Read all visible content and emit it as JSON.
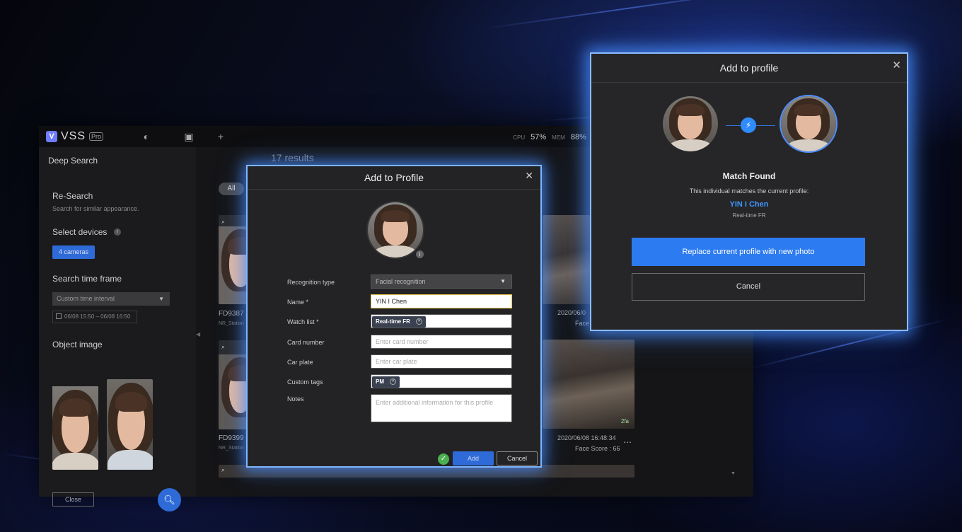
{
  "app": {
    "logo": "VSS",
    "logo_badge": "Pro",
    "cpu_label": "CPU",
    "cpu_value": "57%",
    "mem_label": "MEM",
    "mem_value": "88%",
    "page_title": "Deep Search"
  },
  "sidebar": {
    "research_title": "Re-Search",
    "research_sub": "Search for similar appearance.",
    "devices_title": "Select devices",
    "cameras_button": "4 cameras",
    "timeframe_title": "Search time frame",
    "timeframe_select": "Custom time interval",
    "date_range": "06/08 15:50 – 06/08 16:50",
    "object_image_title": "Object image",
    "close_button": "Close"
  },
  "results": {
    "count": "17 results",
    "filter_all": "All",
    "cards": [
      {
        "id": "FD9387",
        "sub": "NR_Station"
      },
      {
        "id": "FD9399",
        "sub": "NR_Station"
      },
      {
        "time": "2020/06/0",
        "score": "Face"
      },
      {
        "time": "2020/06/08 16:48:34",
        "score": "Face Score : 66",
        "badge": "2fa"
      }
    ]
  },
  "dialog_add": {
    "title": "Add to Profile",
    "fields": {
      "recognition_type_label": "Recognition type",
      "recognition_type_value": "Facial recognition",
      "name_label": "Name *",
      "name_value": "YIN I Chen",
      "watchlist_label": "Watch list *",
      "watchlist_tag": "Real-time FR",
      "card_label": "Card number",
      "card_placeholder": "Enter card number",
      "plate_label": "Car plate",
      "plate_placeholder": "Enter car plate",
      "tags_label": "Custom tags",
      "tags_tag": "PM",
      "notes_label": "Notes",
      "notes_placeholder": "Enter additional information for this profile"
    },
    "add_button": "Add",
    "cancel_button": "Cancel"
  },
  "dialog_match": {
    "title": "Add to profile",
    "match_title": "Match Found",
    "match_desc": "This individual matches the current profile:",
    "match_name": "YIN I Chen",
    "match_list": "Real-time FR",
    "replace_button": "Replace current profile with new photo",
    "cancel_button": "Cancel"
  },
  "colors": {
    "accent": "#2d7bf0",
    "glow": "#7fb4ff",
    "match_name": "#3f95ff"
  }
}
